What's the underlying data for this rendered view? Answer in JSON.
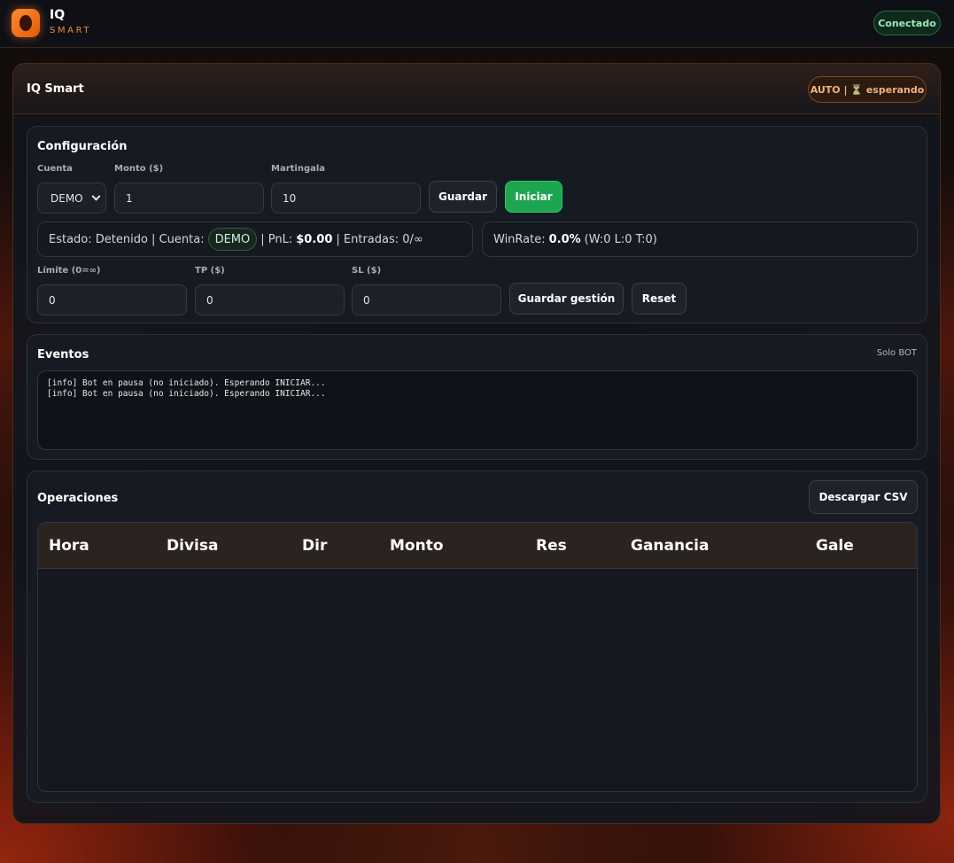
{
  "topbar": {
    "brand_title": "IQ",
    "brand_subtitle": "SMART",
    "connection_status": "Conectado"
  },
  "panel": {
    "title": "IQ Smart",
    "mode_badge": "AUTO | ⏳ esperando"
  },
  "config": {
    "title": "Configuración",
    "account_label": "Cuenta",
    "account_value": "DEMO",
    "amount_label": "Monto ($)",
    "amount_value": "1",
    "martingale_label": "Martingala",
    "martingale_value": "10",
    "save_label": "Guardar",
    "start_label": "Iniciar",
    "status": {
      "estado_prefix": "Estado: Detenido | Cuenta:",
      "account_pill": "DEMO",
      "pnl_prefix": "| PnL:",
      "pnl_value": "$0.00",
      "entries_text": "| Entradas: 0/∞"
    },
    "winrate": {
      "prefix": "WinRate:",
      "value": "0.0%",
      "detail": "(W:0 L:0 T:0)"
    },
    "limit_label": "Límite (0=∞)",
    "limit_value": "0",
    "tp_label": "TP ($)",
    "tp_value": "0",
    "sl_label": "SL ($)",
    "sl_value": "0",
    "save_management_label": "Guardar gestión",
    "reset_label": "Reset"
  },
  "events": {
    "title": "Eventos",
    "filter_label": "Solo BOT",
    "lines": [
      "[info] Bot en pausa (no iniciado). Esperando INICIAR...",
      "[info] Bot en pausa (no iniciado). Esperando INICIAR..."
    ]
  },
  "operations": {
    "title": "Operaciones",
    "download_label": "Descargar CSV",
    "columns": [
      "Hora",
      "Divisa",
      "Dir",
      "Monto",
      "Res",
      "Ganancia",
      "Gale"
    ],
    "rows": []
  },
  "colors": {
    "accent_orange": "#e48d3c",
    "success_green": "#1ea552",
    "panel_bg": "#12161e"
  }
}
